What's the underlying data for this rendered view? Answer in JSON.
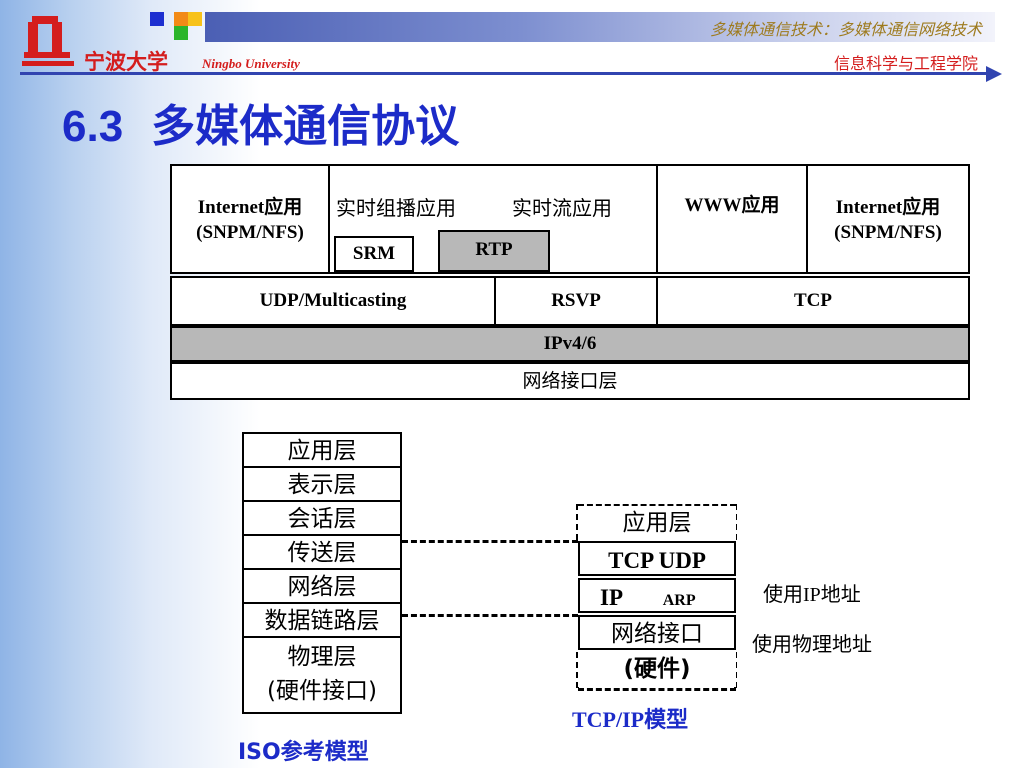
{
  "header": {
    "university_cn": "宁波大学",
    "university_en": "Ningbo University",
    "course": "多媒体通信技术：多媒体通信网络技术",
    "school": "信息科学与工程学院"
  },
  "title": {
    "number": "6.3",
    "text": "多媒体通信协议"
  },
  "stack": {
    "apps": [
      {
        "line1": "Internet应用",
        "line2": "(SNPM/NFS)"
      },
      {
        "line1": "实时组播应用"
      },
      {
        "line1": "实时流应用"
      },
      {
        "line1": "WWW应用"
      },
      {
        "line1": "Internet应用",
        "line2": "(SNPM/NFS)"
      }
    ],
    "srm": "SRM",
    "rtp": "RTP",
    "transport": [
      "UDP/Multicasting",
      "RSVP",
      "TCP"
    ],
    "network": "IPv4/6",
    "interface": "网络接口层"
  },
  "iso": {
    "layers": [
      "应用层",
      "表示层",
      "会话层",
      "传送层",
      "网络层",
      "数据链路层"
    ],
    "physical_line1": "物理层",
    "physical_line2": "(硬件接口)",
    "caption": "ISO参考模型"
  },
  "tcpip": {
    "layers": [
      "应用层",
      "TCP  UDP",
      "IP",
      "网络接口",
      "(硬件)"
    ],
    "arp": "ARP",
    "caption": "TCP/IP模型",
    "note_ip": "使用IP地址",
    "note_phys": "使用物理地址"
  },
  "colors": {
    "title": "#1c2bc8",
    "brand_red": "#d41d1d",
    "gray_cell": "#b8b8b8"
  }
}
